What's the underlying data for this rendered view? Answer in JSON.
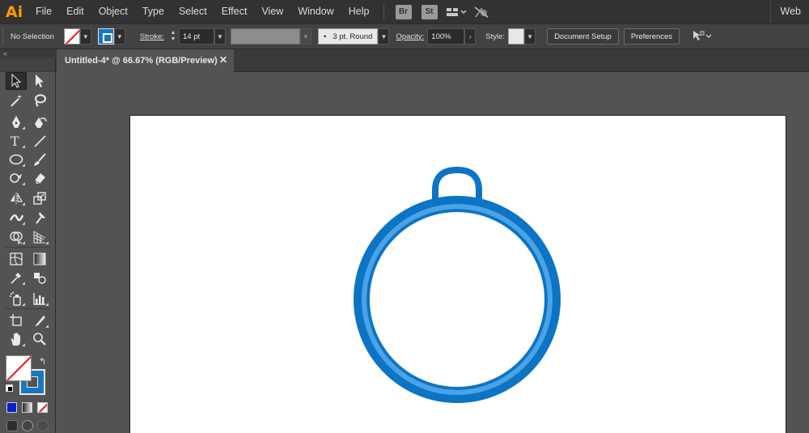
{
  "app": {
    "logo": "Ai",
    "workspace": "Web"
  },
  "menu": [
    "File",
    "Edit",
    "Object",
    "Type",
    "Select",
    "Effect",
    "View",
    "Window",
    "Help"
  ],
  "menu_icons": {
    "bridge": "Br",
    "stock": "St"
  },
  "control": {
    "selection_label": "No Selection",
    "stroke_label": "Stroke:",
    "stroke_value": "14 pt",
    "brush_label": "3 pt. Round",
    "opacity_label": "Opacity:",
    "opacity_value": "100%",
    "style_label": "Style:",
    "document_setup": "Document Setup",
    "preferences": "Preferences"
  },
  "document": {
    "tab_title": "Untitled-4* @ 66.67% (RGB/Preview)",
    "close": "✕"
  },
  "colors": {
    "accent": "#ff9a00",
    "stroke_blue": "#0c74c4",
    "inner_blue": "#4aa3e6",
    "fill_default": "#ffffff"
  },
  "tools": [
    "selection-tool",
    "direct-selection-tool",
    "magic-wand-tool",
    "lasso-tool",
    "pen-tool",
    "curvature-tool",
    "type-tool",
    "line-segment-tool",
    "ellipse-tool",
    "paintbrush-tool",
    "shaper-tool",
    "eraser-tool",
    "reflect-tool",
    "scale-tool",
    "width-tool",
    "puppet-warp-tool",
    "shape-builder-tool",
    "perspective-grid-tool",
    "mesh-tool",
    "gradient-tool",
    "eyedropper-tool",
    "blend-tool",
    "symbol-sprayer-tool",
    "column-graph-tool",
    "artboard-tool",
    "slice-tool",
    "hand-tool",
    "zoom-tool"
  ]
}
